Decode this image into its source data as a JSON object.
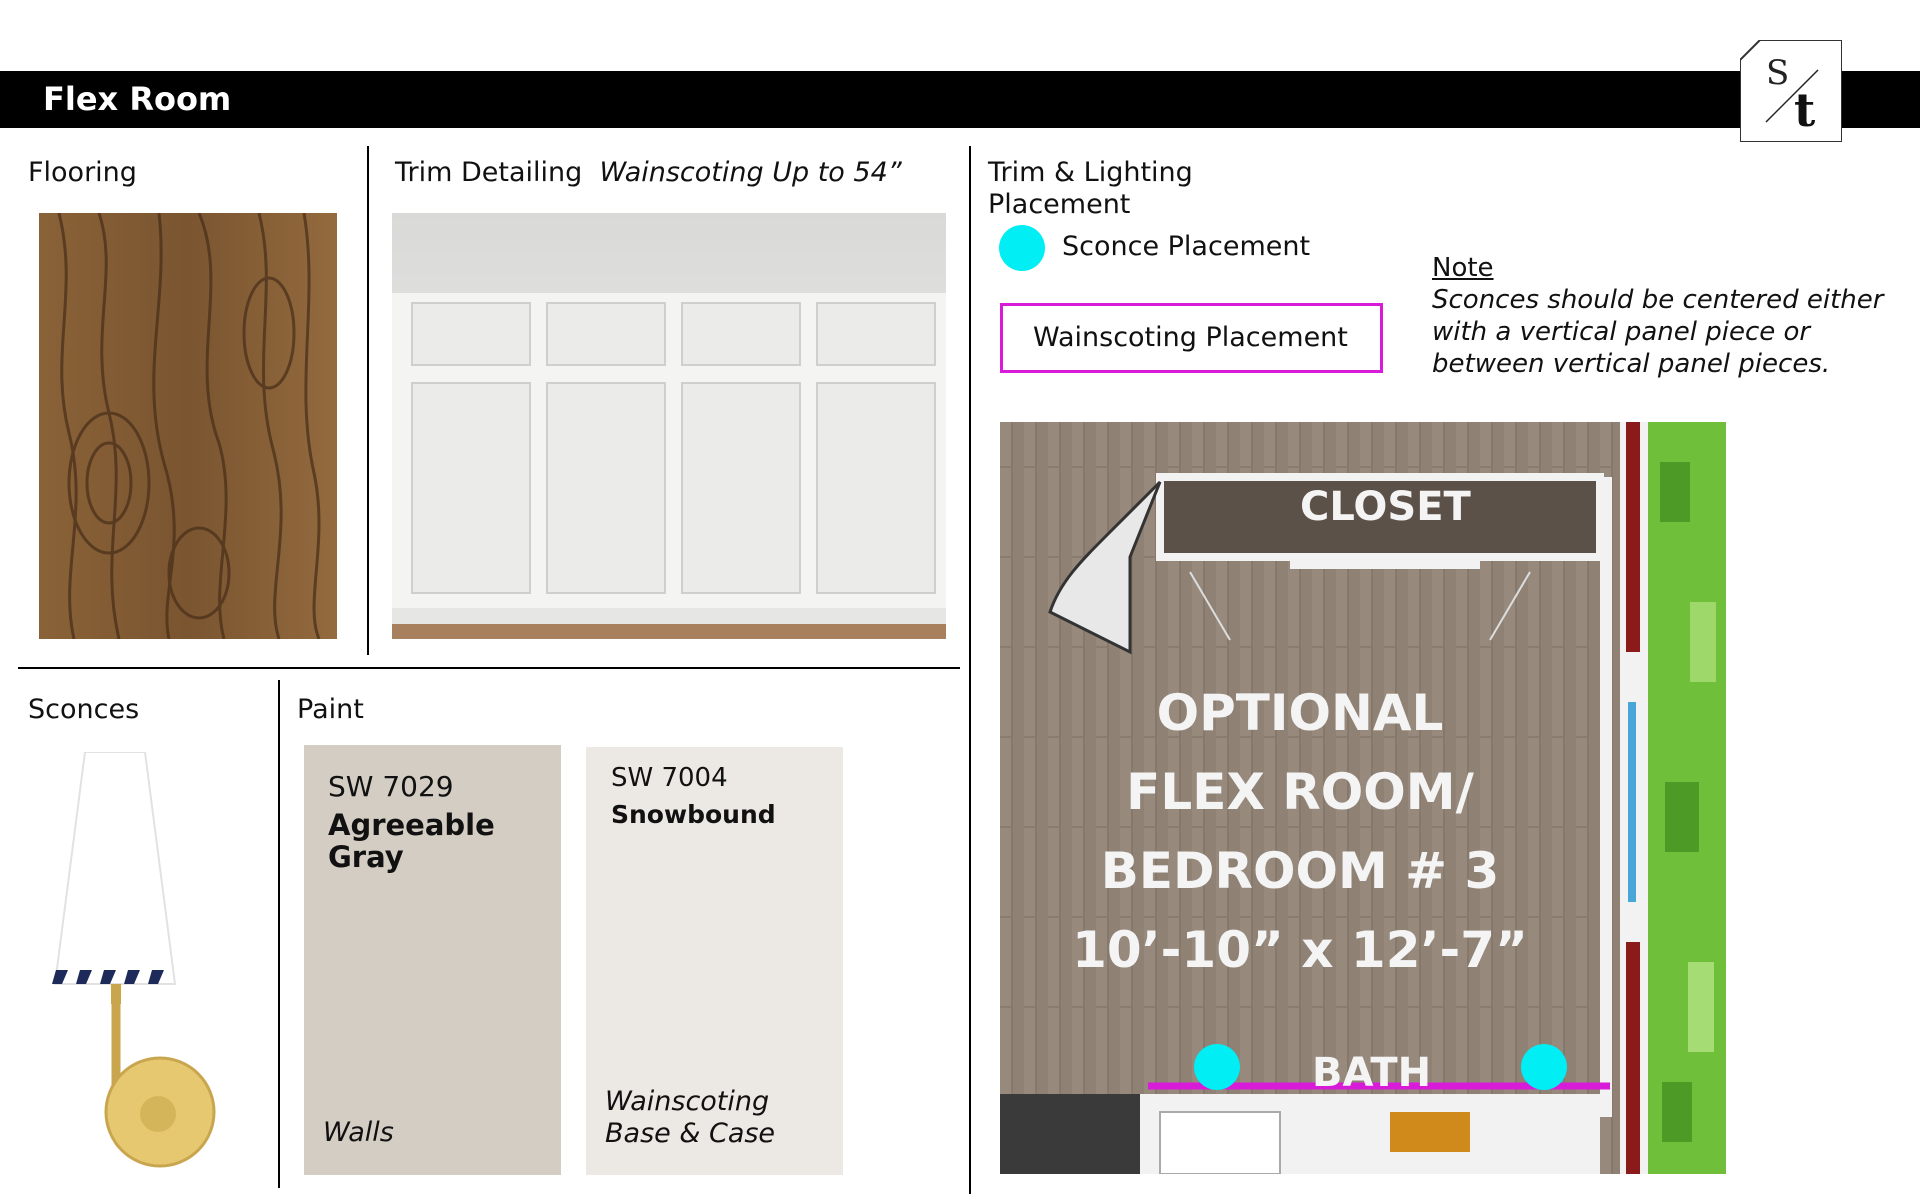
{
  "header": {
    "title": "Flex Room",
    "logo_text": "S/t"
  },
  "flooring": {
    "label": "Flooring"
  },
  "trim": {
    "label": "Trim Detailing",
    "detail": "Wainscoting Up to 54”"
  },
  "placement": {
    "label_line1": "Trim & Lighting",
    "label_line2": "Placement",
    "sconce_legend": "Sconce Placement",
    "wainscoting_legend": "Wainscoting Placement",
    "sconce_color": "#00eef4",
    "wainscoting_color": "#d81bd8"
  },
  "note": {
    "title": "Note",
    "body_line1": "Sconces should be centered either",
    "body_line2": "with a vertical panel piece or",
    "body_line3": "between vertical panel pieces."
  },
  "sconces": {
    "label": "Sconces"
  },
  "paint": {
    "label": "Paint",
    "swatches": [
      {
        "code": "SW 7029",
        "name_line1": "Agreeable",
        "name_line2": "Gray",
        "use_line1": "Walls",
        "use_line2": "",
        "color": "#d4cdc4"
      },
      {
        "code": "SW 7004",
        "name_line1": "Snowbound",
        "name_line2": "",
        "use_line1": "Wainscoting",
        "use_line2": "Base & Case",
        "color": "#ece8e3"
      }
    ]
  },
  "floorplan": {
    "closet": "CLOSET",
    "room_line1": "OPTIONAL",
    "room_line2": "FLEX ROOM/",
    "room_line3": "BEDROOM # 3",
    "room_line4": "10’-10” x 12’-7”",
    "bath": "BATH"
  }
}
